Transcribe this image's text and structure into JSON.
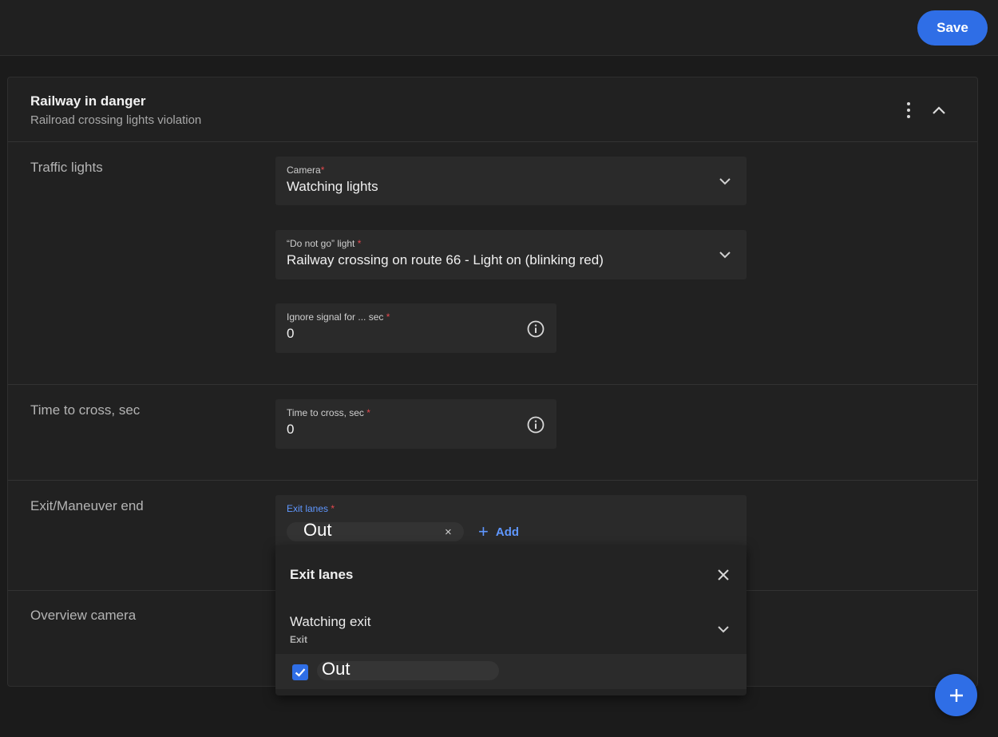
{
  "toolbar": {
    "save_label": "Save"
  },
  "card": {
    "title": "Railway in danger",
    "subtitle": "Railroad crossing lights violation"
  },
  "sections": {
    "traffic_lights": {
      "label": "Traffic lights",
      "camera": {
        "label": "Camera",
        "value": "Watching lights"
      },
      "do_not_go": {
        "label": "“Do not go” light ",
        "value": "Railway crossing on route 66 - Light on (blinking red)"
      },
      "ignore": {
        "label": "Ignore signal for ... sec ",
        "value": "0"
      }
    },
    "time_to_cross": {
      "label": "Time to cross, sec",
      "field": {
        "label": "Time to cross, sec ",
        "value": "0"
      }
    },
    "exit": {
      "label": "Exit/Maneuver end",
      "field_label": "Exit lanes ",
      "chip": "Out",
      "chip_close": "×",
      "add_label": "Add"
    },
    "overview": {
      "label": "Overview camera"
    }
  },
  "required_mark": "*",
  "popup": {
    "title": "Exit lanes",
    "group": {
      "name": "Watching exit",
      "sub": "Exit"
    },
    "option": {
      "label": "Out",
      "checked": true
    }
  },
  "colors": {
    "accent": "#2f6ee6",
    "required": "#e5484d",
    "link": "#5f97ff"
  }
}
